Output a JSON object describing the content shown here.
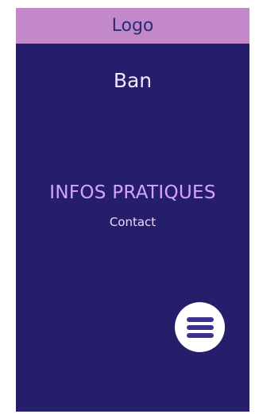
{
  "header": {
    "logo_text": "Logo"
  },
  "banner": {
    "text": "Ban"
  },
  "info": {
    "title": "INFOS PRATIQUES",
    "contact_label": "Contact"
  },
  "menu": {
    "icon": "hamburger-menu-icon"
  },
  "colors": {
    "background": "#251f6b",
    "logo_bar": "#c288c8",
    "title_accent": "#d6a3ff",
    "menu_button": "#ffffff",
    "menu_icon": "#3a328c"
  }
}
